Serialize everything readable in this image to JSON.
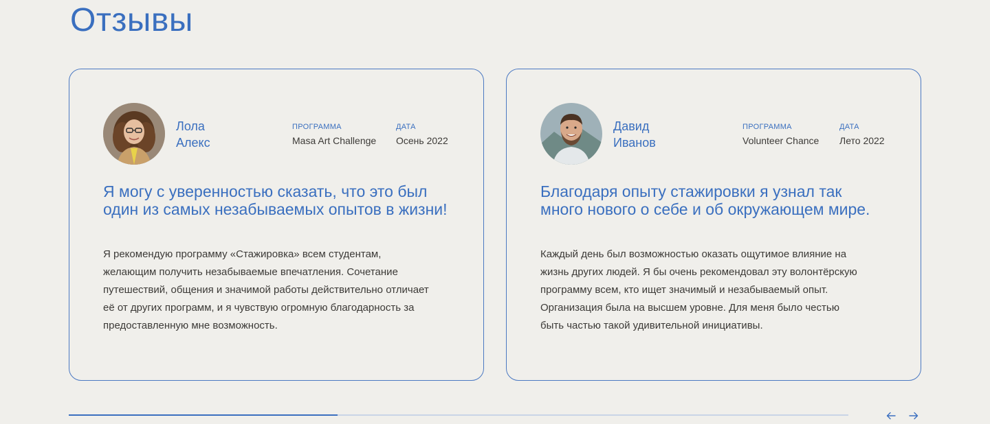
{
  "section": {
    "title": "Отзывы"
  },
  "reviews": [
    {
      "first_name": "Лола",
      "last_name": "Алекс",
      "program_label": "ПРОГРАММА",
      "program": "Masa Art Challenge",
      "date_label": "ДАТА",
      "date": "Осень 2022",
      "headline": "Я могу с уверенностью сказать, что это был один из самых незабываемых опытов в жизни!",
      "text": "Я рекомендую программу «Стажировка» всем студентам, желающим получить незабываемые впечатления. Сочетание путешествий, общения и значимой работы действительно отличает её от других программ, и я чувствую огромную благодарность за предоставленную мне возможность."
    },
    {
      "first_name": "Давид",
      "last_name": "Иванов",
      "program_label": "ПРОГРАММА",
      "program": "Volunteer Chance",
      "date_label": "ДАТА",
      "date": "Лето 2022",
      "headline": "Благодаря опыту стажировки я узнал так много нового о себе и об окружающем мире.",
      "text": "Каждый день был возможностью оказать ощутимое влияние на жизнь других людей. Я бы очень рекомендовал эту волонтёрскую программу всем, кто ищет значимый и незабываемый опыт. Организация была на высшем уровне. Для меня было честью быть частью такой удивительной инициативы."
    }
  ],
  "slider": {
    "progress": 0.345
  },
  "colors": {
    "accent": "#3a6fbf",
    "background": "#f0efeb",
    "text": "#3c3a37",
    "track": "#c9d4e6"
  },
  "icons": {
    "prev": "arrow-left-icon",
    "next": "arrow-right-icon"
  }
}
